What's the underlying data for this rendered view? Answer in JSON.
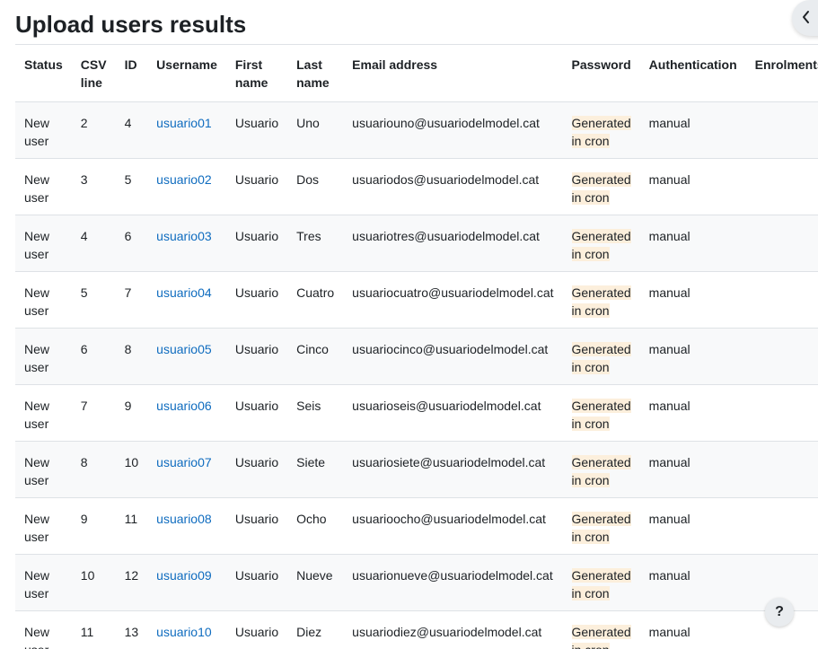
{
  "page": {
    "title": "Upload users results"
  },
  "drawer_toggle": {
    "icon": "chevron-left-icon"
  },
  "help_button": {
    "label": "?"
  },
  "table": {
    "headers": {
      "status": "Status",
      "csv_line": "CSV line",
      "id": "ID",
      "username": "Username",
      "first_name": "First name",
      "last_name": "Last name",
      "email": "Email address",
      "password": "Password",
      "authentication": "Authentication",
      "enrolments": "Enrolments"
    },
    "rows": [
      {
        "status": "New user",
        "csv_line": "2",
        "id": "4",
        "username": "usuario01",
        "first_name": "Usuario",
        "last_name": "Uno",
        "email": "usuariouno@usuariodelmodel.cat",
        "password": "Generated in cron",
        "authentication": "manual",
        "enrolments": ""
      },
      {
        "status": "New user",
        "csv_line": "3",
        "id": "5",
        "username": "usuario02",
        "first_name": "Usuario",
        "last_name": "Dos",
        "email": "usuariodos@usuariodelmodel.cat",
        "password": "Generated in cron",
        "authentication": "manual",
        "enrolments": ""
      },
      {
        "status": "New user",
        "csv_line": "4",
        "id": "6",
        "username": "usuario03",
        "first_name": "Usuario",
        "last_name": "Tres",
        "email": "usuariotres@usuariodelmodel.cat",
        "password": "Generated in cron",
        "authentication": "manual",
        "enrolments": ""
      },
      {
        "status": "New user",
        "csv_line": "5",
        "id": "7",
        "username": "usuario04",
        "first_name": "Usuario",
        "last_name": "Cuatro",
        "email": "usuariocuatro@usuariodelmodel.cat",
        "password": "Generated in cron",
        "authentication": "manual",
        "enrolments": ""
      },
      {
        "status": "New user",
        "csv_line": "6",
        "id": "8",
        "username": "usuario05",
        "first_name": "Usuario",
        "last_name": "Cinco",
        "email": "usuariocinco@usuariodelmodel.cat",
        "password": "Generated in cron",
        "authentication": "manual",
        "enrolments": ""
      },
      {
        "status": "New user",
        "csv_line": "7",
        "id": "9",
        "username": "usuario06",
        "first_name": "Usuario",
        "last_name": "Seis",
        "email": "usuarioseis@usuariodelmodel.cat",
        "password": "Generated in cron",
        "authentication": "manual",
        "enrolments": ""
      },
      {
        "status": "New user",
        "csv_line": "8",
        "id": "10",
        "username": "usuario07",
        "first_name": "Usuario",
        "last_name": "Siete",
        "email": "usuariosiete@usuariodelmodel.cat",
        "password": "Generated in cron",
        "authentication": "manual",
        "enrolments": ""
      },
      {
        "status": "New user",
        "csv_line": "9",
        "id": "11",
        "username": "usuario08",
        "first_name": "Usuario",
        "last_name": "Ocho",
        "email": "usuarioocho@usuariodelmodel.cat",
        "password": "Generated in cron",
        "authentication": "manual",
        "enrolments": ""
      },
      {
        "status": "New user",
        "csv_line": "10",
        "id": "12",
        "username": "usuario09",
        "first_name": "Usuario",
        "last_name": "Nueve",
        "email": "usuarionueve@usuariodelmodel.cat",
        "password": "Generated in cron",
        "authentication": "manual",
        "enrolments": ""
      },
      {
        "status": "New user",
        "csv_line": "11",
        "id": "13",
        "username": "usuario10",
        "first_name": "Usuario",
        "last_name": "Diez",
        "email": "usuariodiez@usuariodelmodel.cat",
        "password": "Generated in cron",
        "authentication": "manual",
        "enrolments": ""
      }
    ]
  }
}
